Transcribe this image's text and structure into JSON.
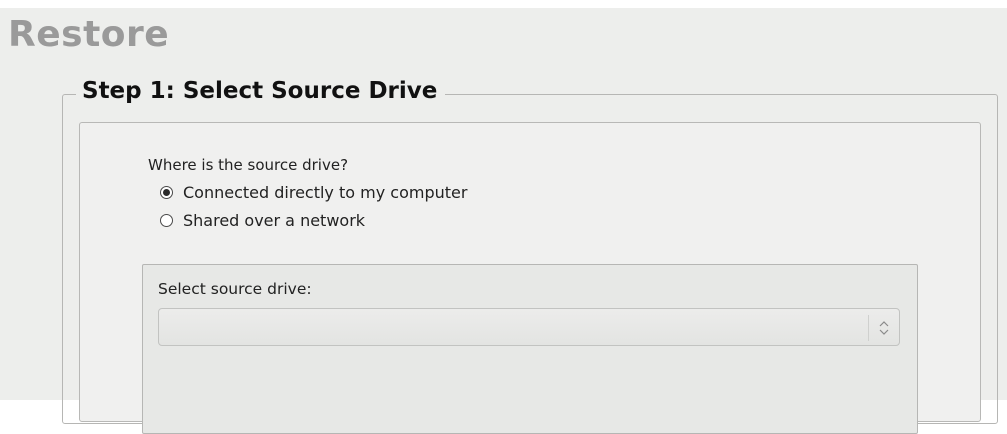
{
  "page": {
    "title": "Restore"
  },
  "step": {
    "title": "Step 1: Select Source Drive",
    "question": "Where is the source drive?",
    "options": [
      {
        "label": "Connected directly to my computer",
        "selected": true
      },
      {
        "label": "Shared over a network",
        "selected": false
      }
    ]
  },
  "drive_select": {
    "label": "Select source drive:",
    "value": "",
    "icon": "chevron-up-down-icon"
  },
  "colors": {
    "title_gray": "#9a9a9a",
    "window_bg": "#edeeec",
    "frame_border": "#b6b6b4"
  }
}
